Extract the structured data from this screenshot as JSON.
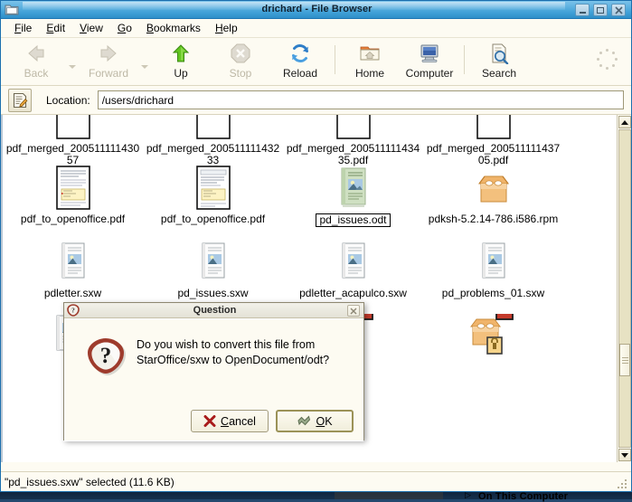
{
  "window": {
    "title": "drichard - File Browser",
    "icon": "folder-icon",
    "minimize_label": "–",
    "maximize_label": "□",
    "close_label": "✕"
  },
  "menubar": {
    "items": [
      {
        "label": "File",
        "accel": "F"
      },
      {
        "label": "Edit",
        "accel": "E"
      },
      {
        "label": "View",
        "accel": "V"
      },
      {
        "label": "Go",
        "accel": "G"
      },
      {
        "label": "Bookmarks",
        "accel": "B"
      },
      {
        "label": "Help",
        "accel": "H"
      }
    ]
  },
  "toolbar": {
    "buttons": [
      {
        "label": "Back",
        "icon": "arrow-left-icon",
        "disabled": true,
        "has_menu_arrow": true
      },
      {
        "label": "Forward",
        "icon": "arrow-right-icon",
        "disabled": true,
        "has_menu_arrow": true
      },
      {
        "label": "Up",
        "icon": "arrow-up-icon",
        "disabled": false
      },
      {
        "label": "Stop",
        "icon": "stop-icon",
        "disabled": true
      },
      {
        "label": "Reload",
        "icon": "reload-icon",
        "disabled": false
      },
      {
        "label": "Home",
        "icon": "home-folder-icon",
        "disabled": false
      },
      {
        "label": "Computer",
        "icon": "computer-icon",
        "disabled": false
      },
      {
        "label": "Search",
        "icon": "search-icon",
        "disabled": false
      }
    ],
    "throbber": "spinner-icon"
  },
  "location": {
    "edit_icon": "edit-location-icon",
    "label": "Location:",
    "value": "/users/drichard",
    "placeholder": ""
  },
  "files": [
    [
      {
        "name": "pdf_merged_20051111143057",
        "icon": "blank-document-icon",
        "selected": false
      },
      {
        "name": "pdf_merged_20051111143233",
        "icon": "blank-document-icon",
        "selected": false
      },
      {
        "name": "pdf_merged_20051111143435.pdf",
        "icon": "blank-document-icon",
        "selected": false
      },
      {
        "name": "pdf_merged_20051111143705.pdf",
        "icon": "blank-document-icon",
        "selected": false
      }
    ],
    [
      {
        "name": "pdf_to_openoffice.pdf",
        "icon": "pdf-preview-icon",
        "selected": false
      },
      {
        "name": "pdf_to_openoffice.pdf",
        "icon": "pdf-preview-icon",
        "selected": false
      },
      {
        "name": "pd_issues.odt",
        "icon": "odt-document-icon",
        "selected": true
      },
      {
        "name": "pdksh-5.2.14-786.i586.rpm",
        "icon": "rpm-package-icon",
        "selected": false
      }
    ],
    [
      {
        "name": "pdletter.sxw",
        "icon": "sxw-document-icon",
        "selected": false
      },
      {
        "name": "pd_issues.sxw",
        "icon": "sxw-document-icon",
        "selected": false
      },
      {
        "name": "pdletter_acapulco.sxw",
        "icon": "sxw-document-icon",
        "selected": false
      },
      {
        "name": "pd_problems_01.sxw",
        "icon": "sxw-document-icon",
        "selected": false
      }
    ],
    [
      {
        "name": "",
        "icon": "sxw-document-locked-icon",
        "selected": false
      },
      {
        "name": "",
        "icon": "us-map-image-icon",
        "selected": false
      },
      {
        "name": "",
        "icon": "rpm-package-locked-icon",
        "selected": false
      },
      {
        "name": "",
        "icon": "rpm-package-locked-icon",
        "selected": false
      }
    ]
  ],
  "scrollbar": {
    "up_icon": "triangle-up-icon",
    "down_icon": "triangle-down-icon"
  },
  "statusbar": {
    "text": "\"pd_issues.sxw\" selected (11.6 KB)"
  },
  "dialog": {
    "icon": "question-shield-icon",
    "title": "Question",
    "close_label": "✕",
    "message": "Do you wish to convert this file from StarOffice/sxw to OpenDocument/odt?",
    "cancel": {
      "label_pre": "",
      "accel": "C",
      "label_post": "ancel",
      "icon": "x-mark-icon"
    },
    "ok": {
      "label_pre": "",
      "accel": "O",
      "label_post": "K",
      "icon": "check-apply-icon"
    }
  },
  "desktop": {
    "label": "On This Computer",
    "arrow": "▷"
  },
  "colors": {
    "titlebar_accent": "#3e9fd6",
    "window_bg": "#fdfbf2",
    "selection_border": "#000000",
    "dialog_icon_red": "#9e3b2c",
    "cancel_x_red": "#a81b1b",
    "up_arrow_green": "#5fbf1f",
    "reload_blue": "#2f7ec8"
  }
}
